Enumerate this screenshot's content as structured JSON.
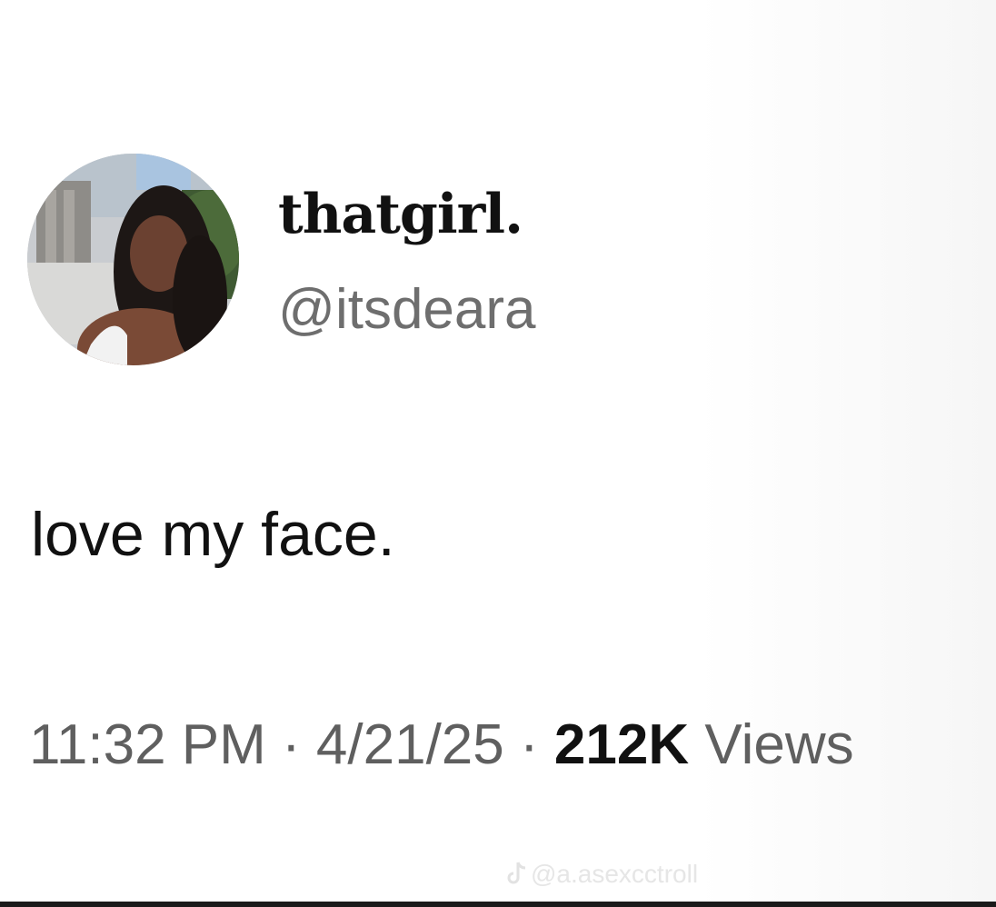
{
  "profile": {
    "display_name": "thatgirl.",
    "handle": "@itsdeara"
  },
  "tweet": {
    "text": "love my face.",
    "time": "11:32 PM",
    "separator": "·",
    "date": "4/21/25",
    "views_count": "212K",
    "views_label": "Views"
  },
  "watermark": {
    "icon": "tiktok-icon",
    "text": "@a.asexcctroll"
  },
  "colors": {
    "text_primary": "#111111",
    "text_secondary": "#6e6e6e",
    "background": "#ffffff"
  }
}
